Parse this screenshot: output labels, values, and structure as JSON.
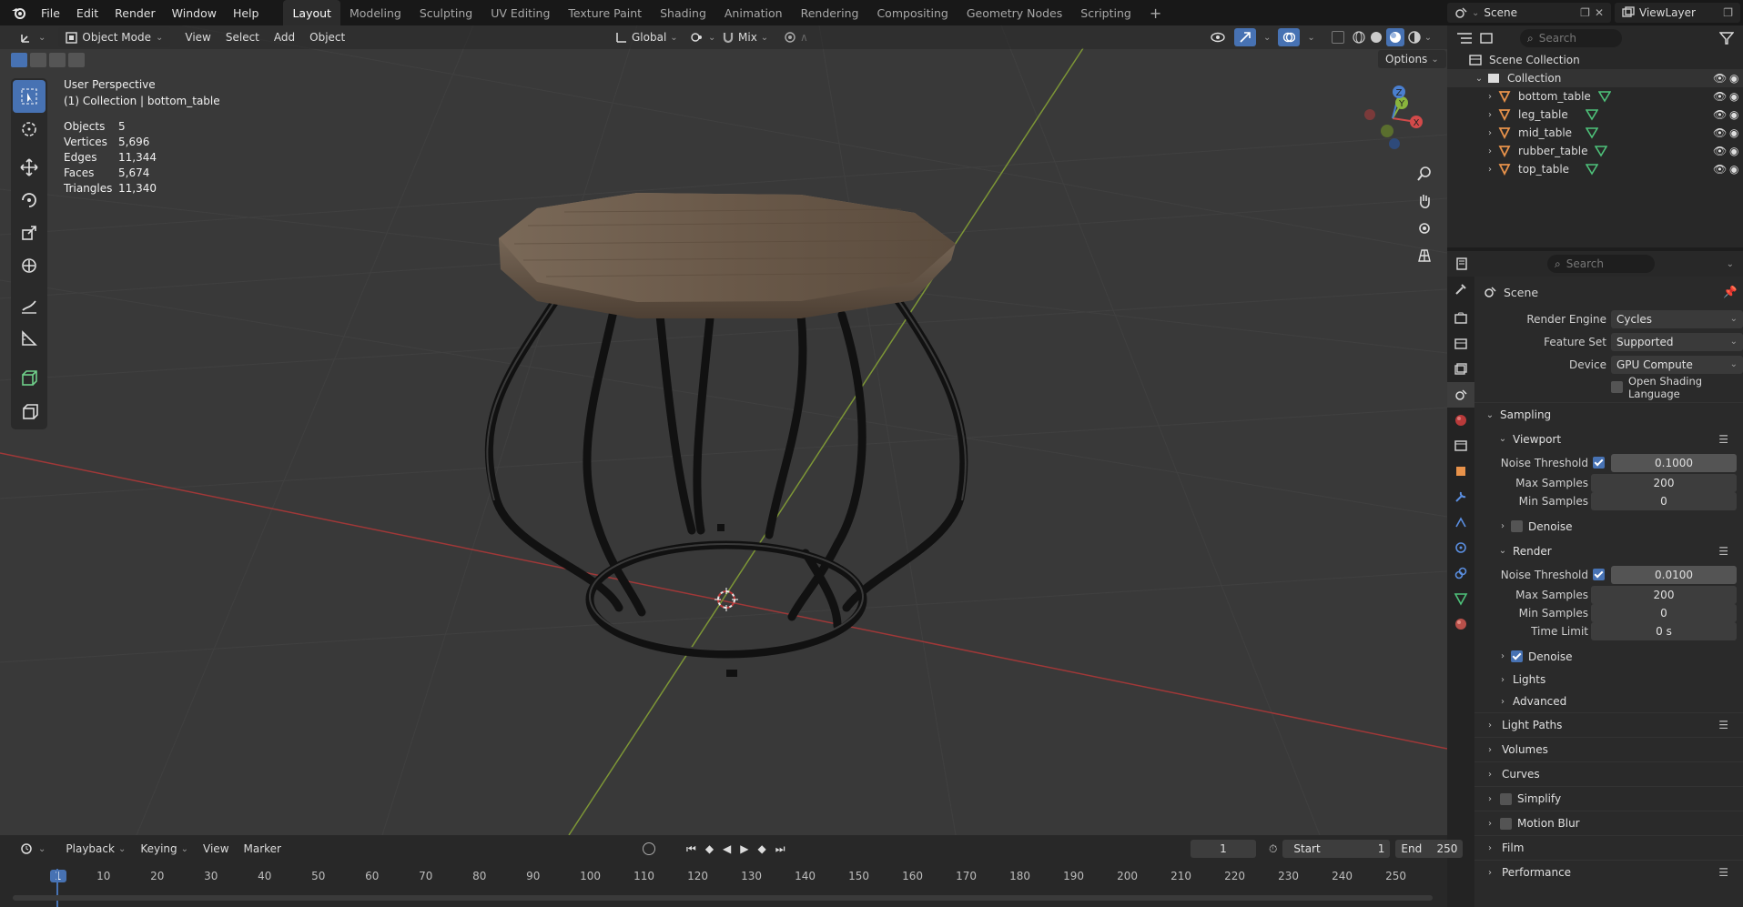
{
  "menu": {
    "file": "File",
    "edit": "Edit",
    "render": "Render",
    "window": "Window",
    "help": "Help"
  },
  "workspaces": [
    "Layout",
    "Modeling",
    "Sculpting",
    "UV Editing",
    "Texture Paint",
    "Shading",
    "Animation",
    "Rendering",
    "Compositing",
    "Geometry Nodes",
    "Scripting"
  ],
  "top_right": {
    "scene": "Scene",
    "viewlayer": "ViewLayer"
  },
  "viewport_header": {
    "mode": "Object Mode",
    "view": "View",
    "select": "Select",
    "add": "Add",
    "object": "Object",
    "orientation": "Global",
    "snap": "Mix",
    "options": "Options"
  },
  "overlay": {
    "perspective": "User Perspective",
    "collection": "(1) Collection | bottom_table"
  },
  "stats": [
    {
      "label": "Objects",
      "value": "5"
    },
    {
      "label": "Vertices",
      "value": "5,696"
    },
    {
      "label": "Edges",
      "value": "11,344"
    },
    {
      "label": "Faces",
      "value": "5,674"
    },
    {
      "label": "Triangles",
      "value": "11,340"
    }
  ],
  "gizmo": {
    "x": "X",
    "y": "Y",
    "z": "Z"
  },
  "outliner": {
    "search": "Search",
    "root": "Scene Collection",
    "collection": "Collection",
    "items": [
      "bottom_table",
      "leg_table",
      "mid_table",
      "rubber_table",
      "top_table"
    ]
  },
  "properties": {
    "search": "Search",
    "context": "Scene",
    "render_engine_label": "Render Engine",
    "render_engine": "Cycles",
    "feature_set_label": "Feature Set",
    "feature_set": "Supported",
    "device_label": "Device",
    "device": "GPU Compute",
    "osl": "Open Shading Language",
    "sampling": "Sampling",
    "viewport": "Viewport",
    "noise_threshold": "Noise Threshold",
    "vp_noise": "0.1000",
    "max_samples": "Max Samples",
    "vp_max": "200",
    "min_samples": "Min Samples",
    "vp_min": "0",
    "denoise": "Denoise",
    "render": "Render",
    "r_noise": "0.0100",
    "r_max": "200",
    "r_min": "0",
    "time_limit": "Time Limit",
    "r_time": "0 s",
    "lights": "Lights",
    "advanced": "Advanced",
    "sections": [
      "Light Paths",
      "Volumes",
      "Curves",
      "Simplify",
      "Motion Blur",
      "Film",
      "Performance"
    ]
  },
  "timeline": {
    "playback": "Playback",
    "keying": "Keying",
    "view": "View",
    "marker": "Marker",
    "current": "1",
    "start_label": "Start",
    "start": "1",
    "end_label": "End",
    "end": "250",
    "ticks": [
      "1",
      "10",
      "20",
      "30",
      "40",
      "50",
      "60",
      "70",
      "80",
      "90",
      "100",
      "110",
      "120",
      "130",
      "140",
      "150",
      "160",
      "170",
      "180",
      "190",
      "200",
      "210",
      "220",
      "230",
      "240",
      "250"
    ]
  },
  "colors": {
    "accent": "#4772b3",
    "x_axis": "#c03a3a",
    "y_axis": "#8aa43a",
    "wood": "#6b5a4a",
    "metal": "#141414",
    "mesh_icon": "#4ec27a",
    "object_icon": "#e8924a"
  }
}
